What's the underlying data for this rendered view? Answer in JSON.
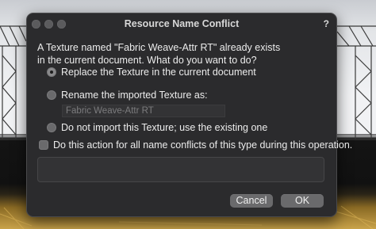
{
  "dialog": {
    "title": "Resource Name Conflict",
    "help_label": "?",
    "message_line1": "A Texture named \"Fabric Weave-Attr RT\" already exists",
    "message_line2": "in the current document.  What do you want to do?",
    "options": [
      {
        "label": "Replace the Texture in the current document",
        "selected": true
      },
      {
        "label": "Rename the imported Texture as:",
        "selected": false
      },
      {
        "label": "Do not import this Texture; use the existing one",
        "selected": false
      }
    ],
    "rename_value": "Fabric Weave-Attr RT",
    "apply_all_label": "Do this action for all name conflicts of this type during this operation.",
    "apply_all_checked": false,
    "cancel_label": "Cancel",
    "ok_label": "OK"
  },
  "colors": {
    "dialog_bg": "#2b2b2d",
    "button_bg": "#6a6a6c",
    "text": "#ececec"
  }
}
